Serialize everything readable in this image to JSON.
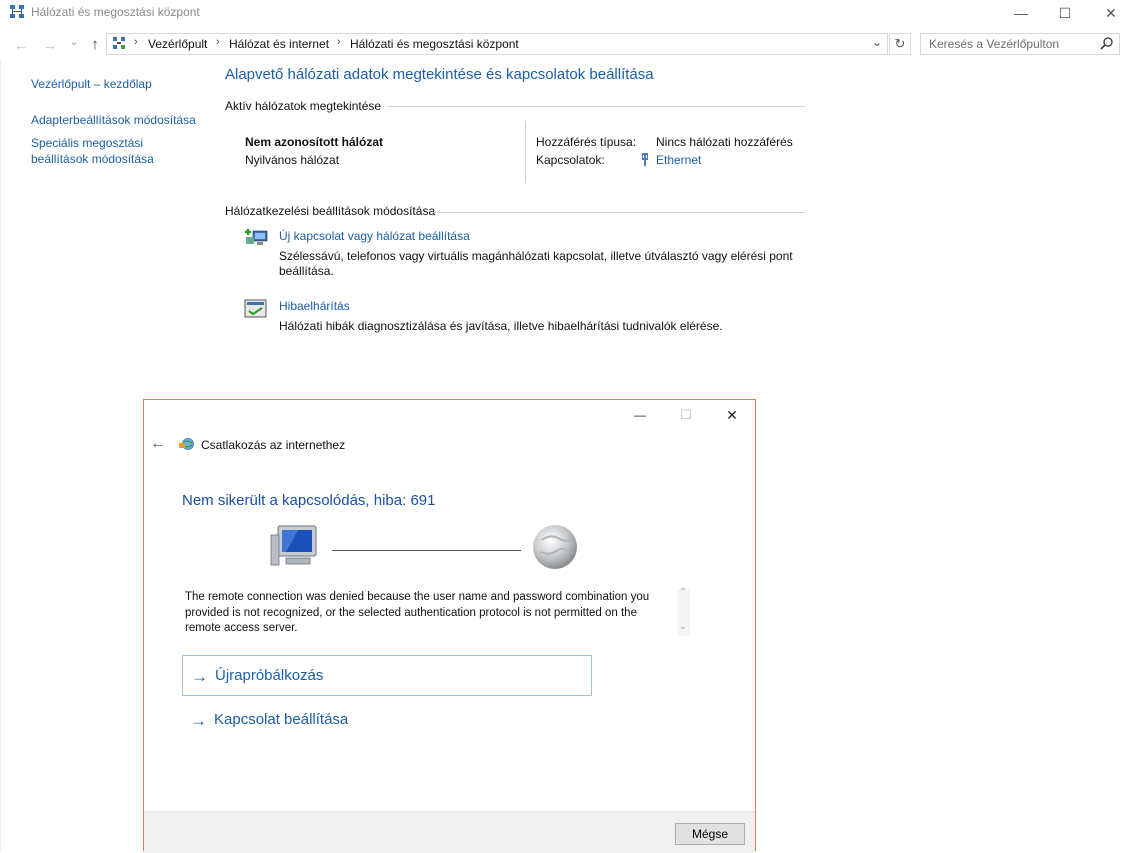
{
  "window": {
    "title": "Hálózati és megosztási központ",
    "minimize_glyph": "—",
    "maximize_glyph": "☐",
    "close_glyph": "✕"
  },
  "nav": {
    "back_glyph": "←",
    "forward_glyph": "→",
    "recent_glyph": "⌄",
    "up_glyph": "↑",
    "breadcrumbs": [
      "Vezérlőpult",
      "Hálózat és internet",
      "Hálózati és megosztási központ"
    ],
    "breadcrumb_sep": "›",
    "dropdown_glyph": "⌄",
    "refresh_glyph": "↻",
    "search_placeholder": "Keresés a Vezérlőpulton"
  },
  "sidebar": {
    "items": [
      {
        "label": "Vezérlőpult – kezdőlap"
      },
      {
        "label": "Adapterbeállítások módosítása"
      },
      {
        "label": "Speciális megosztási beállítások módosítása"
      }
    ]
  },
  "main": {
    "heading": "Alapvető hálózati adatok megtekintése és kapcsolatok beállítása",
    "active_section": "Aktív hálózatok megtekintése",
    "network_name": "Nem azonosított hálózat",
    "network_type": "Nyilvános hálózat",
    "access_type_label": "Hozzáférés típusa:",
    "access_type_value": "Nincs hálózati hozzáférés",
    "connections_label": "Kapcsolatok:",
    "connections_value": "Ethernet",
    "change_section": "Hálózatkezelési beállítások módosítása",
    "new_connection_link": "Új kapcsolat vagy hálózat beállítása",
    "new_connection_desc": "Szélessávú, telefonos vagy virtuális magánhálózati kapcsolat, illetve útválasztó vagy elérési pont beállítása.",
    "troubleshoot_link": "Hibaelhárítás",
    "troubleshoot_desc": "Hálózati hibák diagnosztizálása és javítása, illetve hibaelhárítási tudnivalók elérése."
  },
  "dialog": {
    "minimize_glyph": "—",
    "maximize_glyph": "☐",
    "close_glyph": "✕",
    "back_glyph": "←",
    "title": "Csatlakozás az internethez",
    "error_title": "Nem sikerült a kapcsolódás, hiba: 691",
    "error_text": "The remote connection was denied because the user name and password combination you provided is not recognized, or the selected authentication protocol is not permitted on the remote access server.",
    "scroll_up_glyph": "⌃",
    "scroll_down_glyph": "⌄",
    "action_arrow": "→",
    "retry_label": "Újrapróbálkozás",
    "setup_label": "Kapcsolat beállítása",
    "cancel_label": "Mégse"
  },
  "colors": {
    "link": "#1b5fa8",
    "dialog_border": "#e07a4f",
    "dialog_title": "#1b4f9c"
  }
}
